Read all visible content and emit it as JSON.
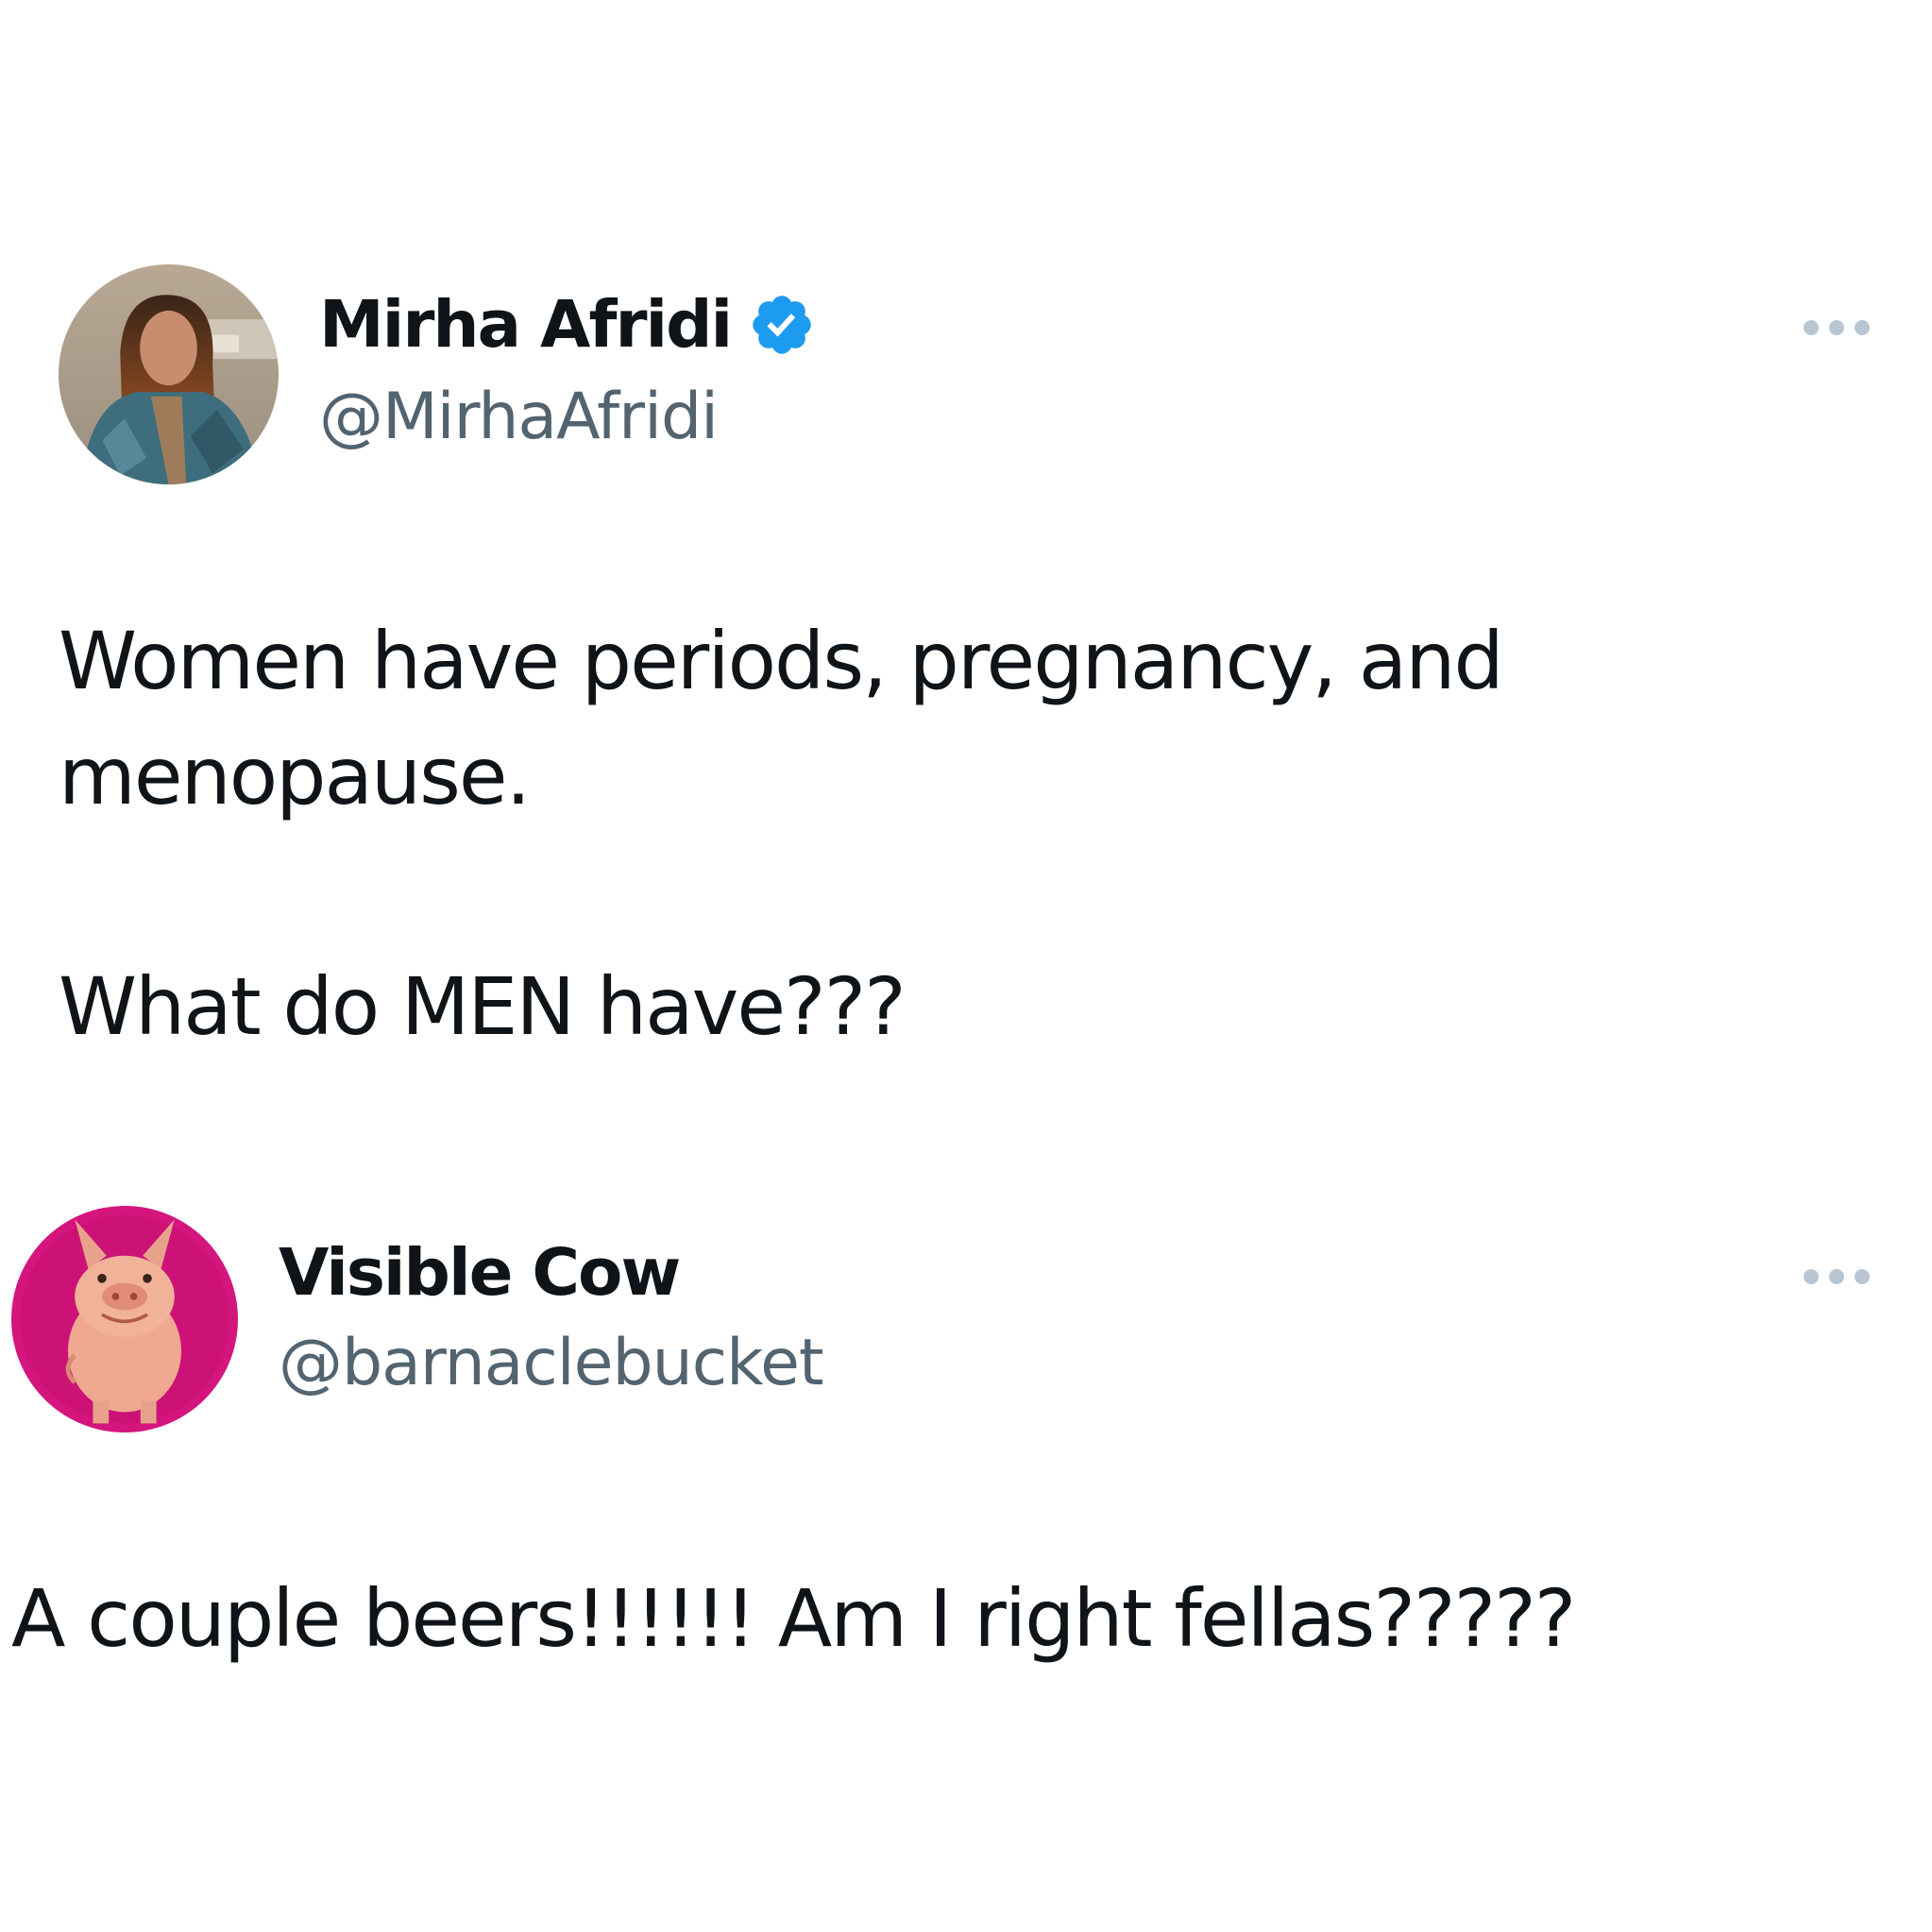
{
  "tweet": {
    "author": {
      "display_name": "Mirha Afridi",
      "handle": "@MirhaAfridi",
      "verified": true,
      "verified_color": "#1d9bf0"
    },
    "text_line_1": "Women have periods, pregnancy, and",
    "text_line_2": "menopause.",
    "text_line_3": "What do MEN have???",
    "more_icon": "more-horizontal-icon"
  },
  "reply": {
    "author": {
      "display_name": "Visible Cow",
      "handle": "@barnaclebucket",
      "avatar_color": "#d4157e"
    },
    "text": "A couple beers!!!!!! Am I right fellas?????",
    "more_icon": "more-horizontal-icon"
  },
  "colors": {
    "text_primary": "#0f1419",
    "text_secondary": "#536471",
    "more_dots": "#b8c6d2"
  }
}
